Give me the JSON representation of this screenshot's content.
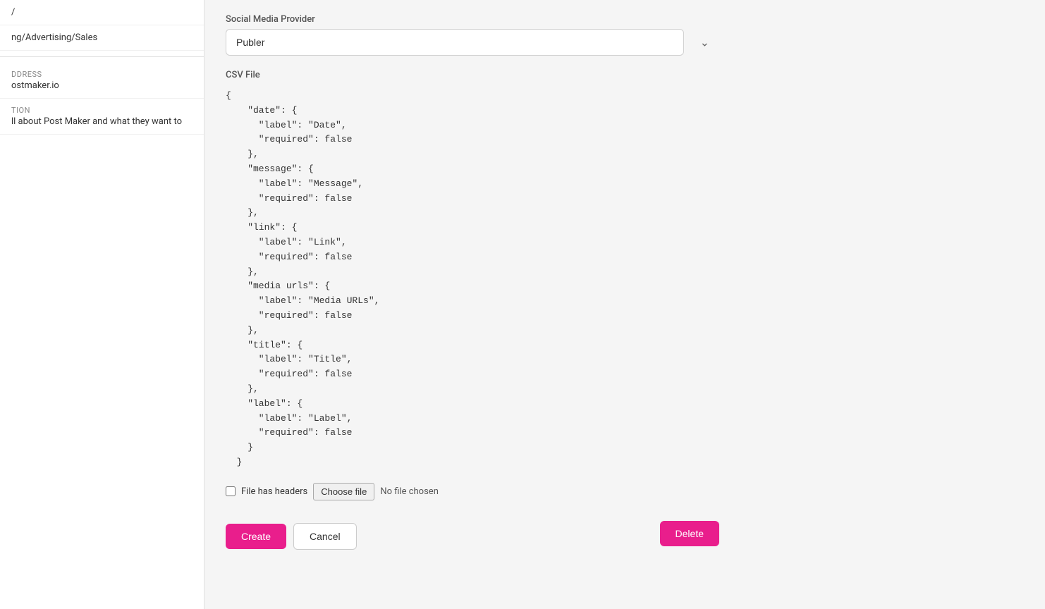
{
  "sidebar": {
    "item1_label": "/",
    "item2_label": "ng/Advertising/Sales",
    "item3_heading": "ddress",
    "item3_value": "ostmaker.io",
    "item4_heading": "tion",
    "item4_value": "ll about Post Maker and what they want to"
  },
  "form": {
    "social_media_provider_label": "Social Media Provider",
    "social_media_provider_value": "Publer",
    "csv_file_label": "CSV File",
    "csv_code": "{\n    \"date\": {\n      \"label\": \"Date\",\n      \"required\": false\n    },\n    \"message\": {\n      \"label\": \"Message\",\n      \"required\": false\n    },\n    \"link\": {\n      \"label\": \"Link\",\n      \"required\": false\n    },\n    \"media urls\": {\n      \"label\": \"Media URLs\",\n      \"required\": false\n    },\n    \"title\": {\n      \"label\": \"Title\",\n      \"required\": false\n    },\n    \"label\": {\n      \"label\": \"Label\",\n      \"required\": false\n    }\n  }",
    "file_has_headers_label": "File has headers",
    "no_file_chosen_label": "No file chosen",
    "choose_file_label": "Choose file",
    "create_button_label": "Create",
    "cancel_button_label": "Cancel",
    "delete_button_label": "Delete"
  }
}
